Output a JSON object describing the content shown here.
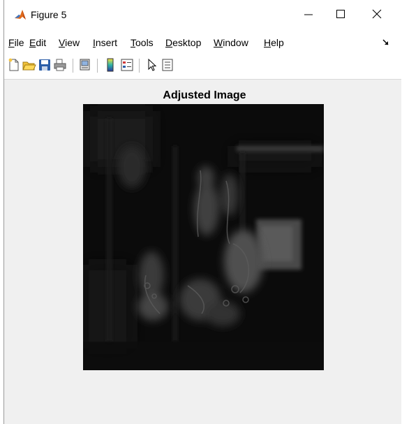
{
  "window": {
    "title": "Figure 5",
    "app_icon": "matlab-logo-icon",
    "controls": {
      "minimize_icon": "minimize-icon",
      "maximize_icon": "maximize-icon",
      "close_icon": "close-icon"
    }
  },
  "menubar": {
    "items": [
      {
        "first": "F",
        "rest": "ile"
      },
      {
        "first": "E",
        "rest": "dit"
      },
      {
        "first": "V",
        "rest": "iew"
      },
      {
        "first": "I",
        "rest": "nsert"
      },
      {
        "first": "T",
        "rest": "ools"
      },
      {
        "first": "D",
        "rest": "esktop"
      },
      {
        "first": "W",
        "rest": "indow"
      },
      {
        "first": "H",
        "rest": "elp"
      }
    ],
    "dock_icon": "dock-arrow-icon"
  },
  "toolbar": {
    "buttons": [
      "new-figure-icon",
      "open-file-icon",
      "save-icon",
      "print-icon",
      "link-plot-icon",
      "colorbar-icon",
      "legend-icon",
      "edit-plot-icon",
      "property-inspector-icon"
    ]
  },
  "figure": {
    "axes_title": "Adjusted Image",
    "image_description_icon": "grayscale-image"
  },
  "colors": {
    "window_bg": "#f0f0f0",
    "chrome_bg": "#ffffff",
    "image_bg": "#0b0b0b"
  }
}
